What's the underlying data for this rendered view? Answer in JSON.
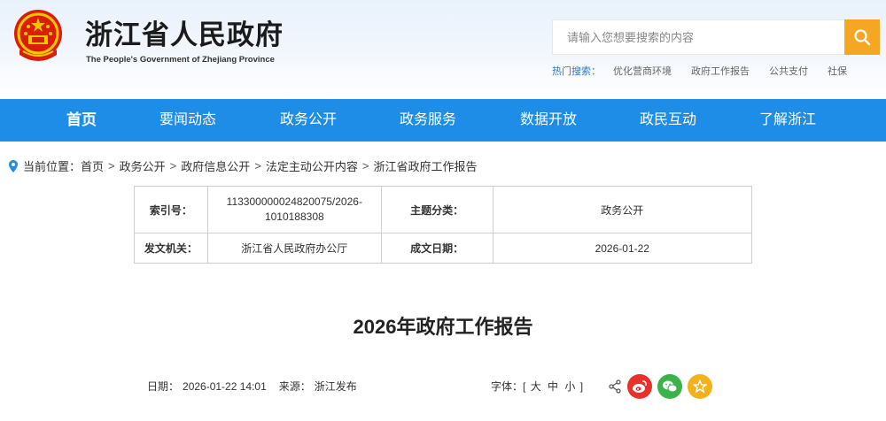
{
  "header": {
    "title": "浙江省人民政府",
    "subtitle": "The People's Government of Zhejiang Province",
    "search_placeholder": "请输入您想要搜索的内容",
    "hot_label": "热门搜索：",
    "hot_items": [
      "优化营商环境",
      "政府工作报告",
      "公共支付",
      "社保"
    ]
  },
  "nav": {
    "items": [
      "首页",
      "要闻动态",
      "政务公开",
      "政务服务",
      "数据开放",
      "政民互动",
      "了解浙江"
    ]
  },
  "breadcrumb": {
    "prefix": "当前位置：",
    "items": [
      "首页",
      "政务公开",
      "政府信息公开",
      "法定主动公开内容",
      "浙江省政府工作报告"
    ]
  },
  "info": {
    "index_label": "索引号：",
    "index_value_1": "113300000024820075/2026-",
    "index_value_2": "1010188308",
    "category_label": "主题分类：",
    "category_value": "政务公开",
    "issuer_label": "发文机关：",
    "issuer_value": "浙江省人民政府办公厅",
    "date_label": "成文日期：",
    "date_value": "2026-01-22"
  },
  "article": {
    "title": "2026年政府工作报告",
    "date_label": "日期：",
    "date_value": "2026-01-22 14:01",
    "source_label": "来源：",
    "source_value": "浙江发布",
    "font_label": "字体：[",
    "font_large": "大",
    "font_medium": "中",
    "font_small": "小",
    "font_close": "]"
  },
  "colors": {
    "nav_blue": "#1d8de7",
    "search_orange": "#f5a623",
    "weibo_red": "#e6322a",
    "wechat_green": "#3bb34a",
    "favorite_yellow": "#f3b21c"
  }
}
